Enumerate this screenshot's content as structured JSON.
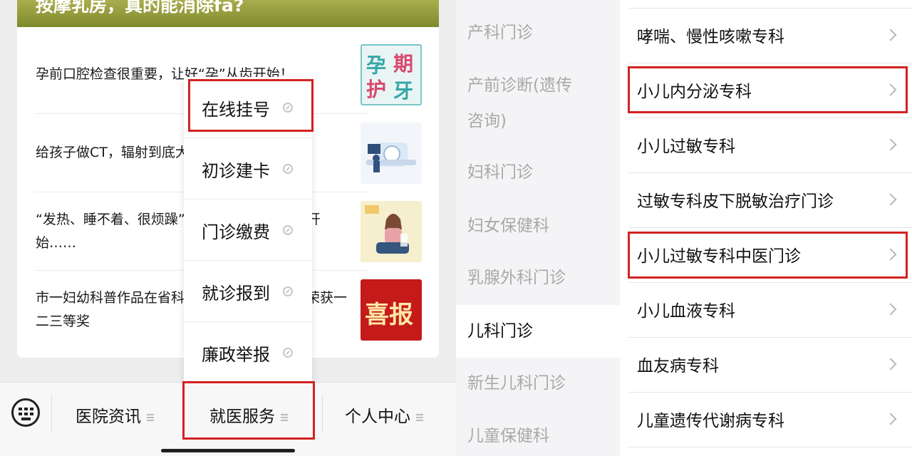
{
  "left": {
    "banner_title": "按摩乳房，真的能消除fa?",
    "articles": [
      {
        "title": "孕前口腔检查很重要，让好“孕”从齿开始！",
        "thumb_text": [
          "孕",
          "期",
          "护",
          "牙"
        ]
      },
      {
        "title": "给孩子做CT，辐射到底大不大？"
      },
      {
        "title": "“发热、睡不着、很烦躁”，或许是「更年期」开始……"
      },
      {
        "title": "市一妇幼科普作品在省科普大赛广东赛区分别荣获一二三等奖",
        "thumb_text": "喜报"
      }
    ],
    "popup_menu": [
      {
        "label": "在线挂号",
        "icon": "link-icon"
      },
      {
        "label": "初诊建卡",
        "icon": "link-icon"
      },
      {
        "label": "门诊缴费",
        "icon": "link-icon"
      },
      {
        "label": "就诊报到",
        "icon": "link-icon"
      },
      {
        "label": "廉政举报",
        "icon": "link-icon"
      }
    ],
    "tabbar": {
      "keyboard_icon": "keyboard-icon",
      "tabs": [
        {
          "label": "医院资讯",
          "icon": "menu-icon"
        },
        {
          "label": "就医服务",
          "icon": "menu-icon"
        },
        {
          "label": "个人中心",
          "icon": "menu-icon"
        }
      ]
    }
  },
  "right": {
    "departments": [
      "产科门诊",
      "产前诊断(遗传",
      "咨询)",
      "妇科门诊",
      "妇女保健科",
      "乳腺外科门诊",
      "儿科门诊",
      "新生儿科门诊",
      "儿童保健科"
    ],
    "active_department": "儿科门诊",
    "specialties": [
      "哮喘、慢性咳嗽专科",
      "小儿内分泌专科",
      "小儿过敏专科",
      "过敏专科皮下脱敏治疗门诊",
      "小儿过敏专科中医门诊",
      "小儿血液专科",
      "血友病专科",
      "儿童遗传代谢病专科"
    ]
  },
  "colors": {
    "highlight_border": "#d32222",
    "banner": "#8f9a38",
    "inactive_text": "#a9a9a9"
  }
}
